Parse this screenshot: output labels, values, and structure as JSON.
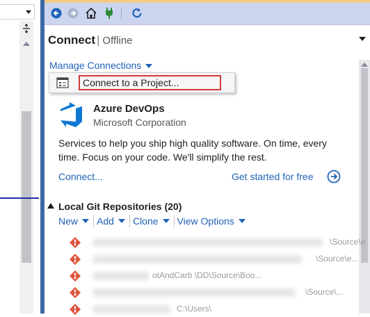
{
  "panel": {
    "title": "Connect",
    "status": "Offline"
  },
  "manage_connections": {
    "label": "Manage Connections"
  },
  "popup": {
    "item_label": "Connect to a Project..."
  },
  "azure": {
    "name": "Azure DevOps",
    "company": "Microsoft Corporation",
    "description": "Services to help you ship high quality software. On time, every time. Focus on your code. We'll simplify the rest.",
    "connect_link": "Connect...",
    "get_started_link": "Get started for free"
  },
  "git": {
    "section_title": "Local Git Repositories (20)",
    "actions": [
      {
        "label": "New"
      },
      {
        "label": "Add"
      },
      {
        "label": "Clone"
      },
      {
        "label": "View Options"
      }
    ],
    "repos": [
      {
        "path": "\\Source\\e"
      },
      {
        "path": "\\Source\\e..."
      },
      {
        "path": "otAndCarb   \\DD\\Source\\Boo..."
      },
      {
        "path": "\\Source\\..."
      },
      {
        "path": "C:\\Users\\"
      }
    ]
  },
  "colors": {
    "accent": "#1e62b8",
    "frame": "#3f67a4",
    "toolbar": "#ccd5f0",
    "highlight_border": "#d33a3a",
    "git_icon": "#e0543c"
  },
  "icons": {
    "toolbar": [
      "back-icon",
      "forward-icon",
      "home-icon",
      "connect-icon",
      "refresh-icon"
    ]
  }
}
